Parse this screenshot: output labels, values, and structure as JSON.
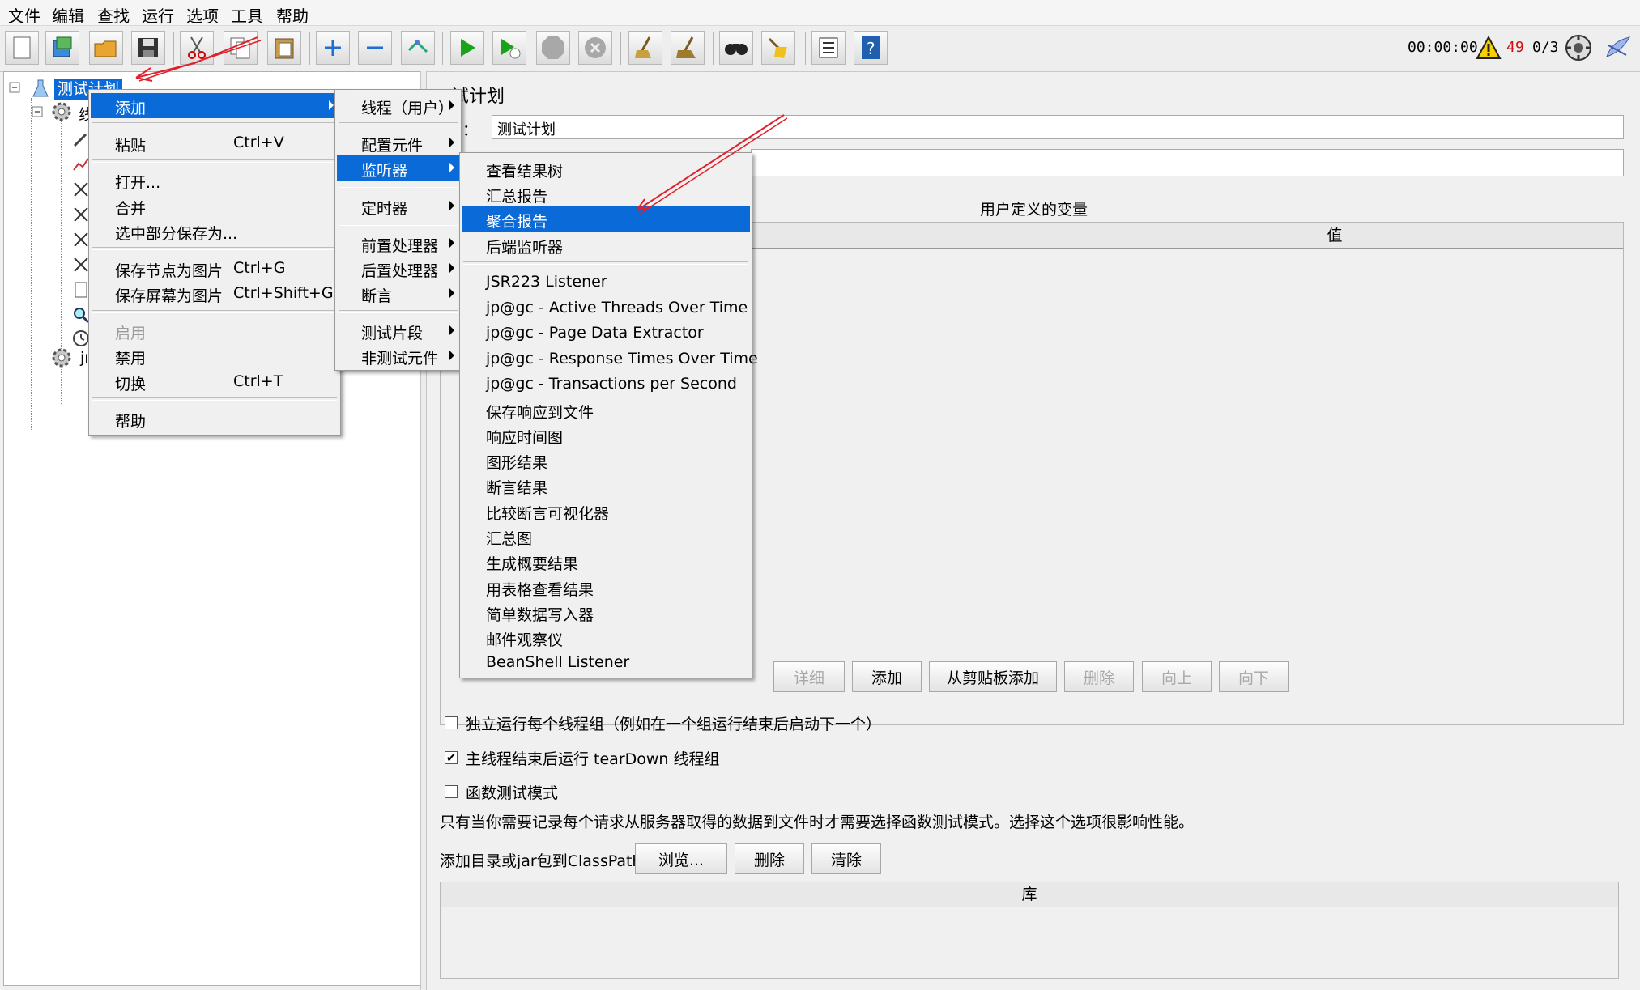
{
  "menubar": [
    "文件",
    "编辑",
    "查找",
    "运行",
    "选项",
    "工具",
    "帮助"
  ],
  "toolbar": {
    "icons": [
      "new-icon",
      "templates-icon",
      "open-icon",
      "save-icon",
      "cut-icon",
      "copy-icon",
      "paste-icon",
      "expand-icon",
      "collapse-icon",
      "toggle-icon",
      "start-icon",
      "start-no-pauses-icon",
      "stop-icon",
      "shutdown-icon",
      "clear-icon",
      "clear-all-icon",
      "search-icon",
      "reset-search-icon",
      "function-helper-icon",
      "help-icon"
    ],
    "elapsed": "00:00:00",
    "warning_count": "49",
    "threads": "0/3"
  },
  "tree": {
    "root": "测试计划",
    "child_fragment_1": "线",
    "child_fragment_2": "jı"
  },
  "context_menu": {
    "items": [
      {
        "label": "添加",
        "shortcut": "",
        "submenu": true,
        "highlighted": true,
        "enabled": true
      },
      {
        "label": "粘贴",
        "shortcut": "Ctrl+V",
        "submenu": false,
        "highlighted": false,
        "enabled": true
      },
      {
        "label": "打开...",
        "shortcut": "",
        "submenu": false,
        "highlighted": false,
        "enabled": true
      },
      {
        "label": "合并",
        "shortcut": "",
        "submenu": false,
        "highlighted": false,
        "enabled": true
      },
      {
        "label": "选中部分保存为...",
        "shortcut": "",
        "submenu": false,
        "highlighted": false,
        "enabled": true
      },
      {
        "label": "保存节点为图片",
        "shortcut": "Ctrl+G",
        "submenu": false,
        "highlighted": false,
        "enabled": true
      },
      {
        "label": "保存屏幕为图片",
        "shortcut": "Ctrl+Shift+G",
        "submenu": false,
        "highlighted": false,
        "enabled": true
      },
      {
        "label": "启用",
        "shortcut": "",
        "submenu": false,
        "highlighted": false,
        "enabled": false
      },
      {
        "label": "禁用",
        "shortcut": "",
        "submenu": false,
        "highlighted": false,
        "enabled": true
      },
      {
        "label": "切换",
        "shortcut": "Ctrl+T",
        "submenu": false,
        "highlighted": false,
        "enabled": true
      },
      {
        "label": "帮助",
        "shortcut": "",
        "submenu": false,
        "highlighted": false,
        "enabled": true
      }
    ]
  },
  "add_submenu": {
    "items": [
      {
        "label": "线程（用户）",
        "highlighted": false
      },
      {
        "label": "配置元件",
        "highlighted": false
      },
      {
        "label": "监听器",
        "highlighted": true
      },
      {
        "label": "定时器",
        "highlighted": false
      },
      {
        "label": "前置处理器",
        "highlighted": false
      },
      {
        "label": "后置处理器",
        "highlighted": false
      },
      {
        "label": "断言",
        "highlighted": false
      },
      {
        "label": "测试片段",
        "highlighted": false
      },
      {
        "label": "非测试元件",
        "highlighted": false
      }
    ]
  },
  "listener_submenu": {
    "items": [
      {
        "label": "查看结果树",
        "highlighted": false
      },
      {
        "label": "汇总报告",
        "highlighted": false
      },
      {
        "label": "聚合报告",
        "highlighted": true
      },
      {
        "label": "后端监听器",
        "highlighted": false
      },
      {
        "label": "JSR223 Listener",
        "highlighted": false
      },
      {
        "label": "jp@gc - Active Threads Over Time",
        "highlighted": false
      },
      {
        "label": "jp@gc - Page Data Extractor",
        "highlighted": false
      },
      {
        "label": "jp@gc - Response Times Over Time",
        "highlighted": false
      },
      {
        "label": "jp@gc - Transactions per Second",
        "highlighted": false
      },
      {
        "label": "保存响应到文件",
        "highlighted": false
      },
      {
        "label": "响应时间图",
        "highlighted": false
      },
      {
        "label": "图形结果",
        "highlighted": false
      },
      {
        "label": "断言结果",
        "highlighted": false
      },
      {
        "label": "比较断言可视化器",
        "highlighted": false
      },
      {
        "label": "汇总图",
        "highlighted": false
      },
      {
        "label": "生成概要结果",
        "highlighted": false
      },
      {
        "label": "用表格查看结果",
        "highlighted": false
      },
      {
        "label": "简单数据写入器",
        "highlighted": false
      },
      {
        "label": "邮件观察仪",
        "highlighted": false
      },
      {
        "label": "BeanShell Listener",
        "highlighted": false
      }
    ]
  },
  "panel": {
    "title_fragment": "试计划",
    "name_label_fragment": "：",
    "name_value": "测试计划",
    "comments_value": "",
    "variables_title": "用户定义的变量",
    "col_value": "值",
    "buttons": [
      {
        "label": "详细",
        "enabled": false
      },
      {
        "label": "添加",
        "enabled": true
      },
      {
        "label": "从剪贴板添加",
        "enabled": true
      },
      {
        "label": "删除",
        "enabled": false
      },
      {
        "label": "向上",
        "enabled": false
      },
      {
        "label": "向下",
        "enabled": false
      }
    ],
    "checkboxes": [
      {
        "label": "独立运行每个线程组（例如在一个组运行结束后启动下一个）",
        "checked": false
      },
      {
        "label": "主线程结束后运行 tearDown 线程组",
        "checked": true
      },
      {
        "label": "函数测试模式",
        "checked": false
      }
    ],
    "note": "只有当你需要记录每个请求从服务器取得的数据到文件时才需要选择函数测试模式。选择这个选项很影响性能。",
    "classpath_label": "添加目录或jar包到ClassPath",
    "classpath_buttons": [
      "浏览...",
      "删除",
      "清除"
    ],
    "lib_header": "库"
  },
  "colors": {
    "highlight": "#0a6ad7",
    "annotation": "#e0202a",
    "warning": "#d01010"
  }
}
